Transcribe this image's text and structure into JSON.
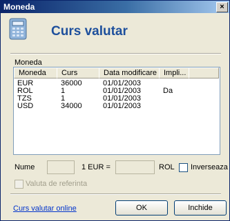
{
  "window": {
    "title": "Moneda",
    "close_glyph": "×"
  },
  "header": {
    "title": "Curs valutar",
    "icon": "calculator-icon"
  },
  "group": {
    "label": "Moneda"
  },
  "table": {
    "columns": [
      "Moneda",
      "Curs",
      "Data modificare",
      "Impli..."
    ],
    "rows": [
      [
        "EUR",
        "36000",
        "01/01/2003",
        ""
      ],
      [
        "ROL",
        "1",
        "01/01/2003",
        "Da"
      ],
      [
        "TZS",
        "1",
        "01/01/2003",
        ""
      ],
      [
        "USD",
        "34000",
        "01/01/2003",
        ""
      ]
    ]
  },
  "form": {
    "nume_label": "Nume",
    "nume_value": "",
    "eur_label": "1 EUR =",
    "rate_value": "",
    "rol_label": "ROL",
    "inverseaza_label": "Inverseaza",
    "inverseaza_checked": false,
    "referinta_label": "Valuta de referinta",
    "referinta_checked": false
  },
  "footer": {
    "link_label": "Curs valutar online",
    "ok_label": "OK",
    "close_label": "Inchide"
  },
  "colors": {
    "accent": "#1d4f9c",
    "titlebar": "#0a246a",
    "link": "#0033cc"
  }
}
